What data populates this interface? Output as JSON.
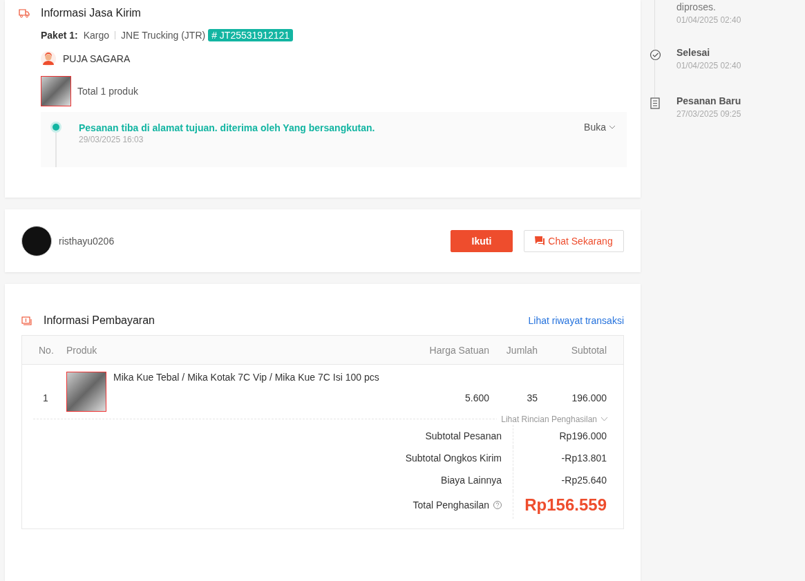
{
  "shipping": {
    "title": "Informasi Jasa Kirim",
    "package_label": "Paket 1:",
    "service_type": "Kargo",
    "courier": "JNE Trucking (JTR)",
    "tracking_number": "# JT25531912121",
    "recipient": "PUJA SAGARA",
    "product_total": "Total 1 produk",
    "tracking": {
      "status": "Pesanan tiba di alamat tujuan. diterima oleh Yang bersangkutan.",
      "time": "29/03/2025 16:03",
      "toggle": "Buka"
    }
  },
  "seller": {
    "username": "risthayu0206",
    "follow_button": "Ikuti",
    "chat_button": "Chat Sekarang"
  },
  "payment": {
    "title": "Informasi Pembayaran",
    "history_link": "Lihat riwayat transaksi",
    "columns": [
      "No.",
      "Produk",
      "Harga Satuan",
      "Jumlah",
      "Subtotal"
    ],
    "rows": [
      {
        "no": "1",
        "product": "Mika Kue Tebal / Mika Kotak 7C Vip / Mika Kue 7C Isi 100 pcs",
        "unit_price": "5.600",
        "quantity": "35",
        "subtotal": "196.000"
      }
    ],
    "details_toggle": "Lihat Rincian Penghasilan",
    "summary": [
      {
        "label": "Subtotal Pesanan",
        "value": "Rp196.000",
        "kind": "line"
      },
      {
        "label": "Subtotal Ongkos Kirim",
        "value": "-Rp13.801",
        "kind": "line"
      },
      {
        "label": "Biaya Lainnya",
        "value": "-Rp25.640",
        "kind": "line"
      },
      {
        "label": "Total Penghasilan",
        "value": "Rp156.559",
        "kind": "total"
      }
    ]
  },
  "order_history": [
    {
      "kind": "none",
      "title": "diproses.",
      "time": "01/04/2025 02:40"
    },
    {
      "kind": "check",
      "title": "Selesai",
      "time": "01/04/2025 02:40"
    },
    {
      "kind": "document",
      "title": "Pesanan Baru",
      "time": "27/03/2025 09:25"
    }
  ]
}
